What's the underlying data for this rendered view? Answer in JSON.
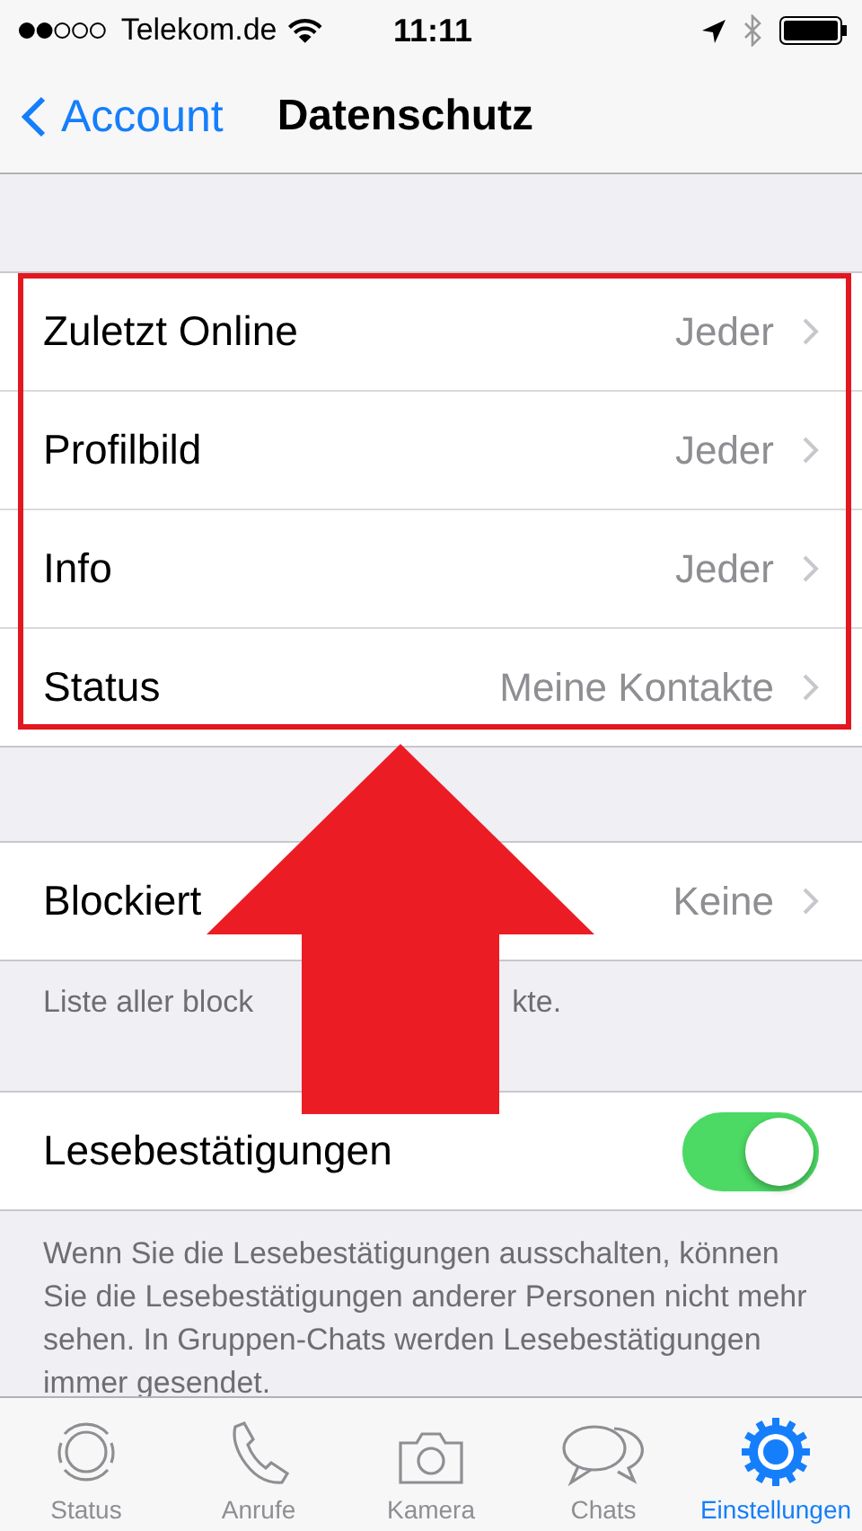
{
  "status_bar": {
    "carrier": "Telekom.de",
    "time": "11:11"
  },
  "nav": {
    "back": "Account",
    "title": "Datenschutz"
  },
  "privacy_rows": [
    {
      "label": "Zuletzt Online",
      "value": "Jeder"
    },
    {
      "label": "Profilbild",
      "value": "Jeder"
    },
    {
      "label": "Info",
      "value": "Jeder"
    },
    {
      "label": "Status",
      "value": "Meine Kontakte"
    }
  ],
  "blocked": {
    "label": "Blockiert",
    "value": "Keine",
    "note_visible_start": "Liste aller block",
    "note_visible_end": "kte."
  },
  "read_receipts": {
    "label": "Lesebestätigungen",
    "on": true,
    "note": "Wenn Sie die Lesebestätigungen ausschalten, können Sie die Lesebestätigungen anderer Personen nicht mehr sehen. In Gruppen-Chats werden Lesebestätigungen immer gesendet."
  },
  "tabs": [
    {
      "label": "Status",
      "kind": "status",
      "selected": false
    },
    {
      "label": "Anrufe",
      "kind": "calls",
      "selected": false
    },
    {
      "label": "Kamera",
      "kind": "camera",
      "selected": false
    },
    {
      "label": "Chats",
      "kind": "chats",
      "selected": false
    },
    {
      "label": "Einstellungen",
      "kind": "settings",
      "selected": true
    }
  ]
}
